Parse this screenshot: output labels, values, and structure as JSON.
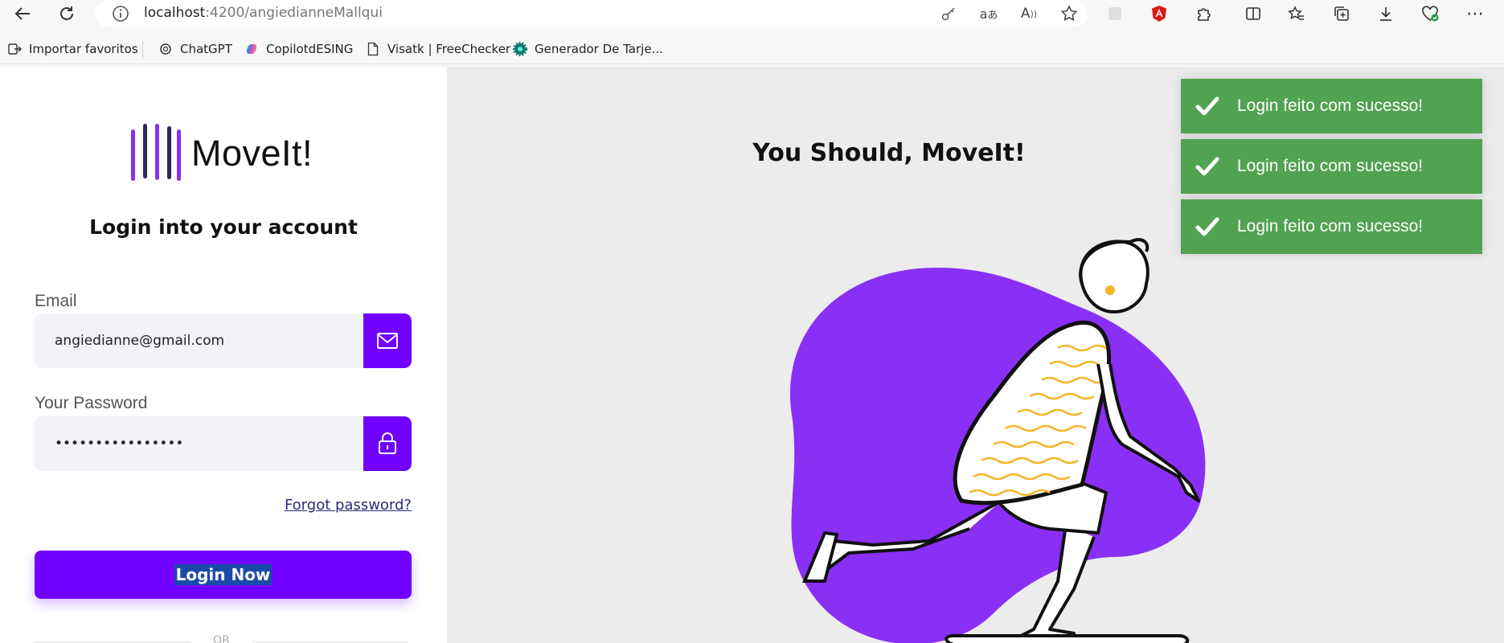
{
  "browser": {
    "url_host": "localhost",
    "url_rest": ":4200/angiedianneMallqui"
  },
  "favorites": [
    {
      "label": "Importar favoritos",
      "icon": "import-icon"
    },
    {
      "label": "ChatGPT",
      "icon": "chatgpt-icon"
    },
    {
      "label": "CopilotdESING",
      "icon": "copilot-icon"
    },
    {
      "label": "Visatk | FreeChecker",
      "icon": "page-icon"
    },
    {
      "label": "Generador De Tarje...",
      "icon": "gear-site-icon"
    }
  ],
  "login": {
    "brand": "MoveIt!",
    "title": "Login into your account",
    "email_label": "Email",
    "email_value": "angiedianne@gmail.com",
    "password_label": "Your Password",
    "password_value": "••••••••••••••••",
    "forgot": "Forgot password?",
    "submit": "Login Now",
    "or": "OR"
  },
  "hero": {
    "title": "You Should, MoveIt!"
  },
  "toasts": [
    {
      "message": "Login feito com sucesso!"
    },
    {
      "message": "Login feito com sucesso!"
    },
    {
      "message": "Login feito com sucesso!"
    }
  ],
  "colors": {
    "accent": "#7000ff",
    "toast": "#51a351",
    "blob": "#8a2ff5"
  }
}
